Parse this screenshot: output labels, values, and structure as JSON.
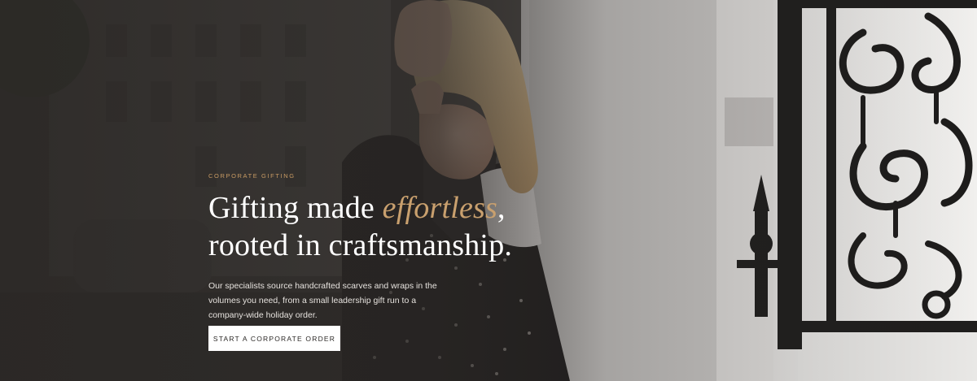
{
  "hero": {
    "eyebrow": "CORPORATE GIFTING",
    "headline_part1": "Gifting made ",
    "headline_emphasis": "effortless",
    "headline_part2": ", rooted in craftsmanship.",
    "body": "Our specialists source handcrafted scarves and wraps in the volumes you need, from a small leadership gift run to a company-wide holiday order.",
    "cta_label": "START A CORPORATE ORDER"
  },
  "colors": {
    "accent": "#c9a06e",
    "overlay": "#2b2826",
    "button_bg": "#ffffff"
  }
}
